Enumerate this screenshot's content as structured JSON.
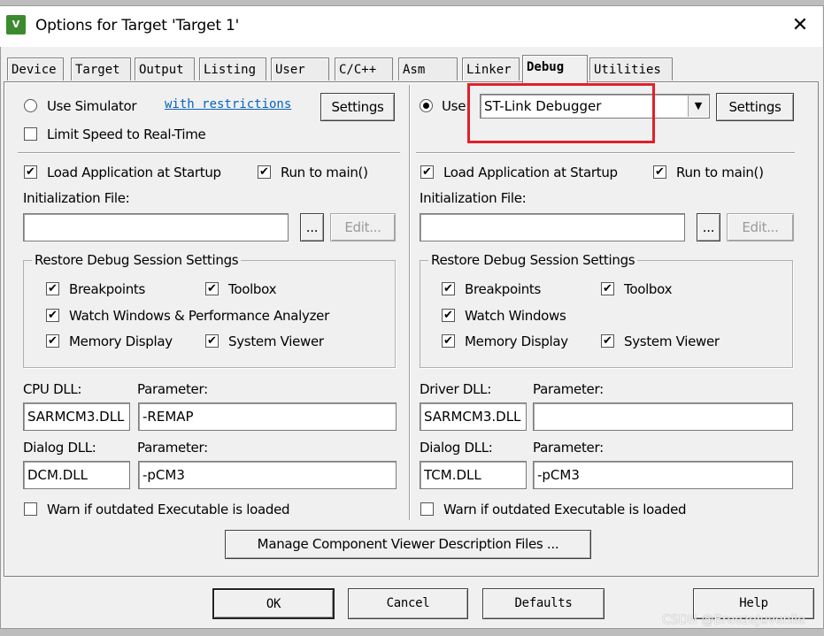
{
  "window": {
    "title": "Options for Target 'Target 1'",
    "icon": "keil-app-icon",
    "close_glyph": "✕"
  },
  "tabs": [
    "Device",
    "Target",
    "Output",
    "Listing",
    "User",
    "C/C++",
    "Asm",
    "Linker",
    "Debug",
    "Utilities"
  ],
  "active_tab": "Debug",
  "left": {
    "use_simulator": "Use Simulator",
    "with_restrictions": "with restrictions",
    "settings": "Settings",
    "limit_speed": "Limit Speed to Real-Time",
    "load_app": "Load Application at Startup",
    "run_to_main": "Run to main()",
    "init_file": "Initialization File:",
    "browse": "...",
    "edit": "Edit...",
    "restore_title": "Restore Debug Session Settings",
    "breakpoints": "Breakpoints",
    "toolbox": "Toolbox",
    "watch": "Watch Windows & Performance Analyzer",
    "memory": "Memory Display",
    "system_viewer": "System Viewer",
    "dll_label": "CPU DLL:",
    "param_label": "Parameter:",
    "dll_value": "SARMCM3.DLL",
    "param_value": "-REMAP",
    "dialog_dll_label": "Dialog DLL:",
    "dialog_param_label": "Parameter:",
    "dialog_dll_value": "DCM.DLL",
    "dialog_param_value": "-pCM3",
    "warn": "Warn if outdated Executable is loaded"
  },
  "right": {
    "use": "Use:",
    "debugger": "ST-Link Debugger",
    "settings": "Settings",
    "load_app": "Load Application at Startup",
    "run_to_main": "Run to main()",
    "init_file": "Initialization File:",
    "browse": "...",
    "edit": "Edit...",
    "restore_title": "Restore Debug Session Settings",
    "breakpoints": "Breakpoints",
    "toolbox": "Toolbox",
    "watch": "Watch Windows",
    "memory": "Memory Display",
    "system_viewer": "System Viewer",
    "dll_label": "Driver DLL:",
    "param_label": "Parameter:",
    "dll_value": "SARMCM3.DLL",
    "param_value": "",
    "dialog_dll_label": "Dialog DLL:",
    "dialog_param_label": "Parameter:",
    "dialog_dll_value": "TCM.DLL",
    "dialog_param_value": "-pCM3",
    "warn": "Warn if outdated Executable is loaded"
  },
  "manage_button": "Manage Component Viewer Description Files ...",
  "buttons": {
    "ok": "OK",
    "cancel": "Cancel",
    "defaults": "Defaults",
    "help": "Help"
  },
  "watermark": "CSDN @BreezeJuvenile",
  "highlight_color": "#e0202a"
}
